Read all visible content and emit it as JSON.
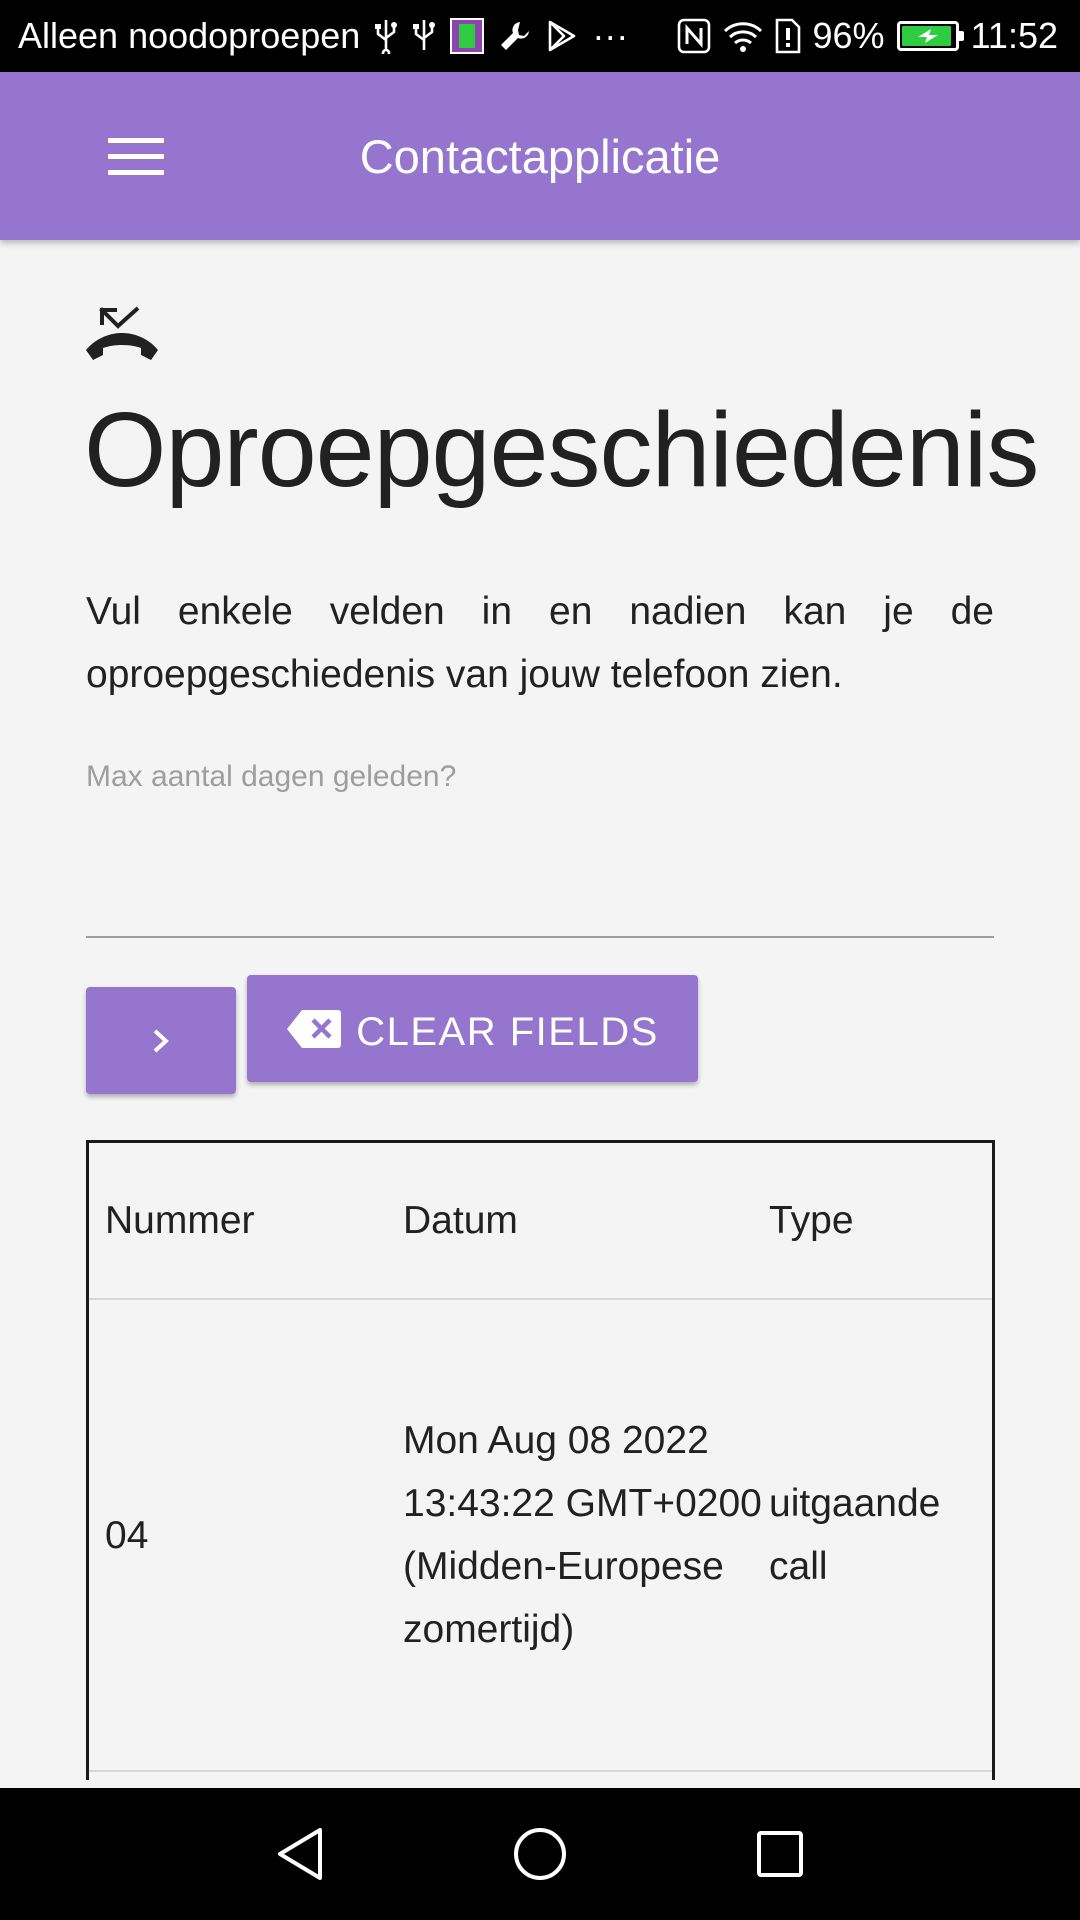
{
  "status_bar": {
    "carrier": "Alleen noodoproepen",
    "more": "···",
    "battery_percent": "96%",
    "battery_level": 0.96,
    "time": "11:52",
    "icons": [
      "usb-icon",
      "usb-icon",
      "app-notification-icon",
      "wrench-icon",
      "play-store-icon",
      "nfc-icon",
      "wifi-icon",
      "sim-alert-icon",
      "battery-charging-icon"
    ]
  },
  "app_bar": {
    "title": "Contactapplicatie",
    "menu_icon": "hamburger-menu-icon"
  },
  "page": {
    "icon": "call-missed-outgoing-icon",
    "title": "Oproepgeschiedenis",
    "intro": "Vul enkele velden in en nadien kan je de oproepgeschiedenis van jouw telefoon zien."
  },
  "form": {
    "days_label": "Max aantal dagen geleden?",
    "days_value": "",
    "submit_icon": "chevron-right-icon",
    "clear_icon": "backspace-icon",
    "clear_label": "CLEAR FIELDS"
  },
  "table": {
    "headers": [
      "Nummer",
      "Datum",
      "Type"
    ],
    "rows": [
      [
        "04",
        "Mon Aug 08 2022 13:43:22 GMT+0200 (Midden-Europese zomertijd)",
        "uitgaande call"
      ]
    ]
  },
  "nav_bar": {
    "icons": [
      "back-triangle-icon",
      "home-circle-icon",
      "recents-square-icon"
    ]
  },
  "colors": {
    "primary": "#9575cd",
    "status_bar": "#000000",
    "background": "#f4f4f4",
    "battery": "#2ecc40"
  }
}
